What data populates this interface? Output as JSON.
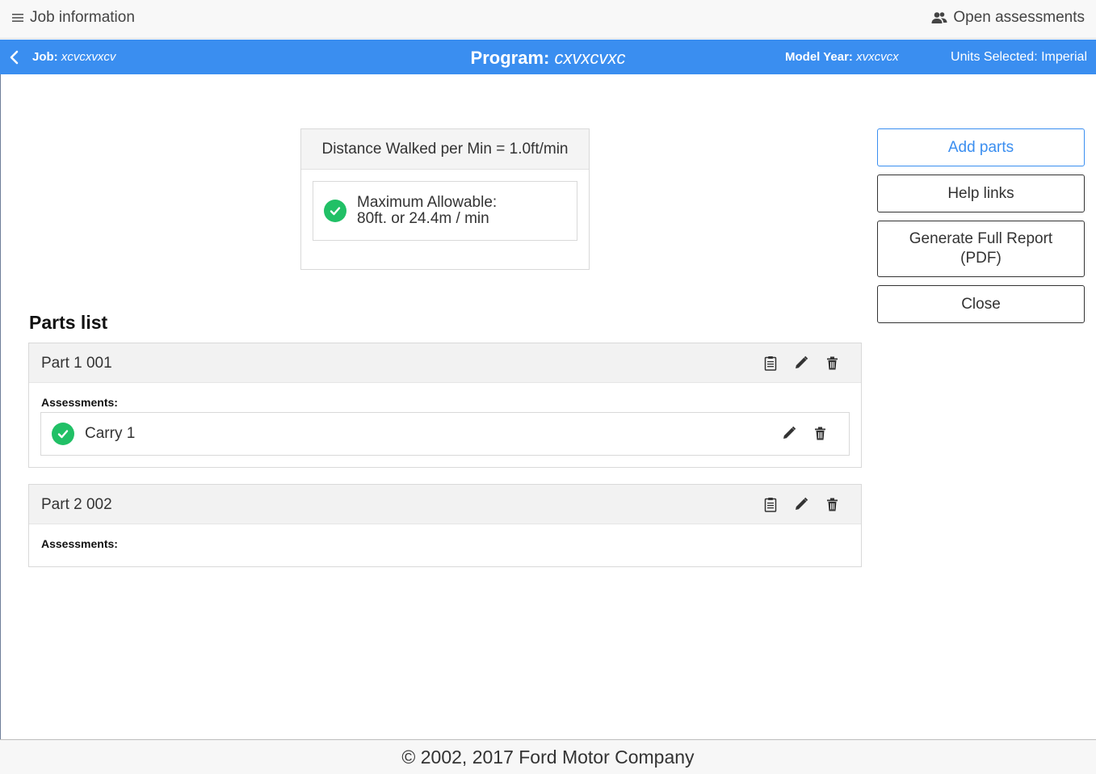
{
  "topbar": {
    "menu_label": "Job information",
    "menu_icon": "hamburger-icon",
    "open_label": "Open assessments",
    "open_icon": "users-icon"
  },
  "header": {
    "back_icon": "chevron-left-icon",
    "job_label": "Job:",
    "job_value": "xcvcxvxcv",
    "program_label": "Program:",
    "program_value": "cxvxcvxc",
    "model_year_label": "Model Year:",
    "model_year_value": "xvxcvcx",
    "units_text": "Units Selected: Imperial",
    "bar_color": "#3a8ef0"
  },
  "distance": {
    "title": "Distance Walked per Min = 1.0ft/min",
    "max_line1": "Maximum Allowable:",
    "max_line2": "80ft. or 24.4m / min",
    "status_icon": "check-circle-icon",
    "status_color": "#21c066"
  },
  "actions": {
    "add_parts": "Add parts",
    "help_links": "Help links",
    "generate_report_line1": "Generate Full Report",
    "generate_report_line2": "(PDF)",
    "close": "Close"
  },
  "parts_list": {
    "title": "Parts list",
    "parts": [
      {
        "name": "Part 1 001",
        "assessments_label": "Assessments:",
        "assessments": [
          {
            "name": "Carry 1",
            "status_icon": "check-circle-icon"
          }
        ]
      },
      {
        "name": "Part 2 002",
        "assessments_label": "Assessments:",
        "assessments": []
      }
    ]
  },
  "footer": {
    "text": "© 2002, 2017 Ford Motor Company"
  }
}
